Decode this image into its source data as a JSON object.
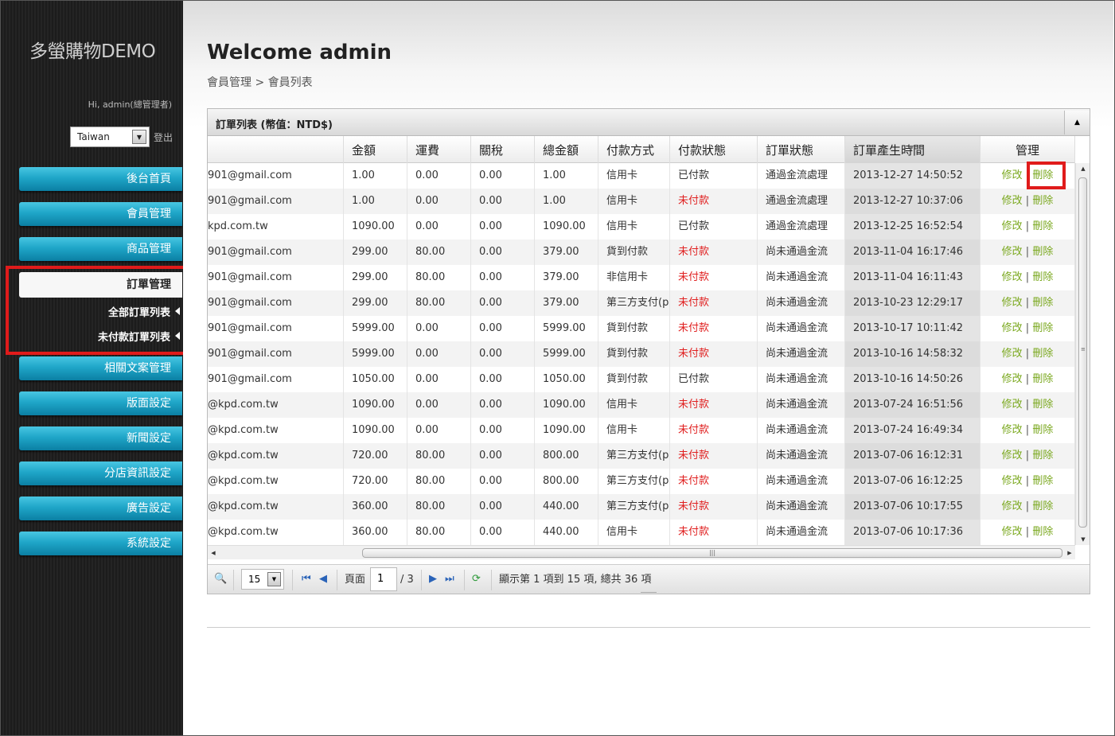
{
  "sidebar": {
    "logo": "多螢購物DEMO",
    "greeting": "Hi, admin(總管理者)",
    "language": "Taiwan",
    "logout": "登出",
    "menu": [
      {
        "label": "後台首頁"
      },
      {
        "label": "會員管理"
      },
      {
        "label": "商品管理"
      }
    ],
    "active": "訂單管理",
    "sub": [
      {
        "label": "全部訂單列表"
      },
      {
        "label": "未付款訂單列表"
      }
    ],
    "menu_after": [
      {
        "label": "相關文案管理"
      },
      {
        "label": "版面設定"
      },
      {
        "label": "新聞設定"
      },
      {
        "label": "分店資訊設定"
      },
      {
        "label": "廣告設定"
      },
      {
        "label": "系統設定"
      }
    ]
  },
  "header": {
    "title": "Welcome admin",
    "breadcrumb": "會員管理 > 會員列表"
  },
  "grid": {
    "title": "訂單列表 (幣值：NTD$)",
    "columns": [
      "",
      "金額",
      "運費",
      "關稅",
      "總金額",
      "付款方式",
      "付款狀態",
      "訂單狀態",
      "訂單產生時間",
      "管理"
    ],
    "edit_label": "修改",
    "delete_label": "刪除",
    "rows": [
      {
        "email": "901@gmail.com",
        "amount": "1.00",
        "shipping": "0.00",
        "tax": "0.00",
        "total": "1.00",
        "payment": "信用卡",
        "pay_status": "已付款",
        "paid": true,
        "order_status": "通過金流處理",
        "time": "2013-12-27 14:50:52"
      },
      {
        "email": "901@gmail.com",
        "amount": "1.00",
        "shipping": "0.00",
        "tax": "0.00",
        "total": "1.00",
        "payment": "信用卡",
        "pay_status": "未付款",
        "paid": false,
        "order_status": "通過金流處理",
        "time": "2013-12-27 10:37:06"
      },
      {
        "email": "kpd.com.tw",
        "amount": "1090.00",
        "shipping": "0.00",
        "tax": "0.00",
        "total": "1090.00",
        "payment": "信用卡",
        "pay_status": "已付款",
        "paid": true,
        "order_status": "通過金流處理",
        "time": "2013-12-25 16:52:54"
      },
      {
        "email": "901@gmail.com",
        "amount": "299.00",
        "shipping": "80.00",
        "tax": "0.00",
        "total": "379.00",
        "payment": "貨到付款",
        "pay_status": "未付款",
        "paid": false,
        "order_status": "尚未通過金流",
        "time": "2013-11-04 16:17:46"
      },
      {
        "email": "901@gmail.com",
        "amount": "299.00",
        "shipping": "80.00",
        "tax": "0.00",
        "total": "379.00",
        "payment": "非信用卡",
        "pay_status": "未付款",
        "paid": false,
        "order_status": "尚未通過金流",
        "time": "2013-11-04 16:11:43"
      },
      {
        "email": "901@gmail.com",
        "amount": "299.00",
        "shipping": "80.00",
        "tax": "0.00",
        "total": "379.00",
        "payment": "第三方支付(p",
        "pay_status": "未付款",
        "paid": false,
        "order_status": "尚未通過金流",
        "time": "2013-10-23 12:29:17"
      },
      {
        "email": "901@gmail.com",
        "amount": "5999.00",
        "shipping": "0.00",
        "tax": "0.00",
        "total": "5999.00",
        "payment": "貨到付款",
        "pay_status": "未付款",
        "paid": false,
        "order_status": "尚未通過金流",
        "time": "2013-10-17 10:11:42"
      },
      {
        "email": "901@gmail.com",
        "amount": "5999.00",
        "shipping": "0.00",
        "tax": "0.00",
        "total": "5999.00",
        "payment": "貨到付款",
        "pay_status": "未付款",
        "paid": false,
        "order_status": "尚未通過金流",
        "time": "2013-10-16 14:58:32"
      },
      {
        "email": "901@gmail.com",
        "amount": "1050.00",
        "shipping": "0.00",
        "tax": "0.00",
        "total": "1050.00",
        "payment": "貨到付款",
        "pay_status": "已付款",
        "paid": true,
        "order_status": "尚未通過金流",
        "time": "2013-10-16 14:50:26"
      },
      {
        "email": "@kpd.com.tw",
        "amount": "1090.00",
        "shipping": "0.00",
        "tax": "0.00",
        "total": "1090.00",
        "payment": "信用卡",
        "pay_status": "未付款",
        "paid": false,
        "order_status": "尚未通過金流",
        "time": "2013-07-24 16:51:56"
      },
      {
        "email": "@kpd.com.tw",
        "amount": "1090.00",
        "shipping": "0.00",
        "tax": "0.00",
        "total": "1090.00",
        "payment": "信用卡",
        "pay_status": "未付款",
        "paid": false,
        "order_status": "尚未通過金流",
        "time": "2013-07-24 16:49:34"
      },
      {
        "email": "@kpd.com.tw",
        "amount": "720.00",
        "shipping": "80.00",
        "tax": "0.00",
        "total": "800.00",
        "payment": "第三方支付(p",
        "pay_status": "未付款",
        "paid": false,
        "order_status": "尚未通過金流",
        "time": "2013-07-06 16:12:31"
      },
      {
        "email": "@kpd.com.tw",
        "amount": "720.00",
        "shipping": "80.00",
        "tax": "0.00",
        "total": "800.00",
        "payment": "第三方支付(p",
        "pay_status": "未付款",
        "paid": false,
        "order_status": "尚未通過金流",
        "time": "2013-07-06 16:12:25"
      },
      {
        "email": "@kpd.com.tw",
        "amount": "360.00",
        "shipping": "80.00",
        "tax": "0.00",
        "total": "440.00",
        "payment": "第三方支付(p",
        "pay_status": "未付款",
        "paid": false,
        "order_status": "尚未通過金流",
        "time": "2013-07-06 10:17:55"
      },
      {
        "email": "@kpd.com.tw",
        "amount": "360.00",
        "shipping": "80.00",
        "tax": "0.00",
        "total": "440.00",
        "payment": "信用卡",
        "pay_status": "未付款",
        "paid": false,
        "order_status": "尚未通過金流",
        "time": "2013-07-06 10:17:36"
      }
    ]
  },
  "pager": {
    "page_size": "15",
    "page_label": "頁面",
    "page": "1",
    "total_pages": "/ 3",
    "summary": "顯示第 1 項到 15 項, 總共 36 項"
  },
  "colors": {
    "accent": "#1fa6c8",
    "unpaid": "#e02020",
    "link": "#7aa81e",
    "highlight": "#e01b1b"
  }
}
